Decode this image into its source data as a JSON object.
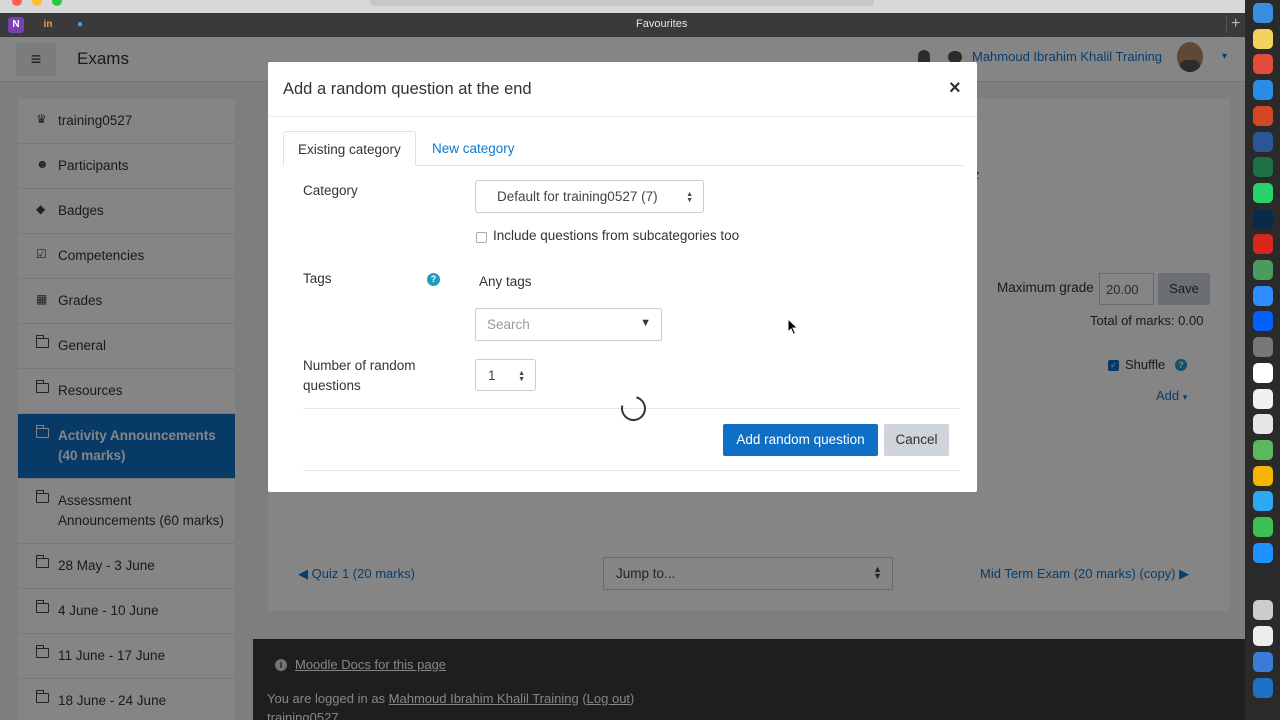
{
  "browser": {
    "favourites_title": "Favourites",
    "fav_icons": [
      {
        "name": "onenote-icon",
        "glyph": "N",
        "color": "#7b3fb4"
      },
      {
        "name": "in-icon",
        "glyph": "in",
        "color": "#c96b12"
      },
      {
        "name": "site-icon",
        "glyph": "•",
        "color": "#1e7fd6"
      }
    ]
  },
  "dock_icons": [
    {
      "name": "finder-icon",
      "color": "#3a8de0"
    },
    {
      "name": "notes-icon",
      "color": "#f3d35d"
    },
    {
      "name": "chrome-icon",
      "color": "#e14d3a"
    },
    {
      "name": "safari-icon",
      "color": "#2a8ce6"
    },
    {
      "name": "powerpoint-icon",
      "color": "#d24726"
    },
    {
      "name": "word-icon",
      "color": "#2b5797"
    },
    {
      "name": "excel-icon",
      "color": "#1e7145"
    },
    {
      "name": "whatsapp-icon",
      "color": "#25d366"
    },
    {
      "name": "photoshop-icon",
      "color": "#0b2a4a"
    },
    {
      "name": "acrobat-icon",
      "color": "#d9261c"
    },
    {
      "name": "drive-icon",
      "color": "#4a9c5e"
    },
    {
      "name": "zoom-icon",
      "color": "#2d8cff"
    },
    {
      "name": "dropbox-icon",
      "color": "#0061fe"
    },
    {
      "name": "launchpad-icon",
      "color": "#777777"
    },
    {
      "name": "calendar-icon",
      "color": "#ffffff"
    },
    {
      "name": "textedit-icon",
      "color": "#f0f0f0"
    },
    {
      "name": "preview-icon",
      "color": "#e6e6e6"
    },
    {
      "name": "maps-icon",
      "color": "#5cb85c"
    },
    {
      "name": "photos-icon",
      "color": "#f4b400"
    },
    {
      "name": "messages-icon",
      "color": "#2fa8f3"
    },
    {
      "name": "facetime-icon",
      "color": "#3cc150"
    },
    {
      "name": "appstore-icon",
      "color": "#1e90ff"
    },
    {
      "name": "trash-icon",
      "color": "#cccccc"
    },
    {
      "name": "file-icon",
      "color": "#eeeeee"
    },
    {
      "name": "browser-icon",
      "color": "#3a7bd5"
    },
    {
      "name": "language-icon",
      "color": "#1f6fc2"
    }
  ],
  "navbar": {
    "menu_glyph": "≡",
    "site_name": "Exams",
    "user_name": "Mahmoud Ibrahim Khalil Training",
    "caret": "▾"
  },
  "sidebar": {
    "items": [
      {
        "label": "training0527",
        "icon": "graduation-cap-icon",
        "glyph": "♛",
        "active": false
      },
      {
        "label": "Participants",
        "icon": "users-icon",
        "glyph": "☻",
        "active": false
      },
      {
        "label": "Badges",
        "icon": "shield-icon",
        "glyph": "◆",
        "active": false
      },
      {
        "label": "Competencies",
        "icon": "checkbox-icon",
        "glyph": "☑",
        "active": false
      },
      {
        "label": "Grades",
        "icon": "table-icon",
        "glyph": "▦",
        "active": false
      },
      {
        "label": "General",
        "icon": "folder-icon",
        "active": false
      },
      {
        "label": "Resources",
        "icon": "folder-icon",
        "active": false
      },
      {
        "label": "Activity Announcements (40 marks)",
        "icon": "folder-icon",
        "active": true
      },
      {
        "label": "Assessment Announcements (60 marks)",
        "icon": "folder-icon",
        "active": false
      },
      {
        "label": "28 May - 3 June",
        "icon": "folder-icon",
        "active": false
      },
      {
        "label": "4 June - 10 June",
        "icon": "folder-icon",
        "active": false
      },
      {
        "label": "11 June - 17 June",
        "icon": "folder-icon",
        "active": false
      },
      {
        "label": "18 June - 24 June",
        "icon": "folder-icon",
        "active": false
      }
    ]
  },
  "main": {
    "partial_z": "z",
    "max_grade_label": "Maximum grade",
    "max_grade_value": "20.00",
    "save_label": "Save",
    "total_marks": "Total of marks: 0.00",
    "shuffle_label": "Shuffle",
    "add_label": "Add",
    "prev_link": "◀ Quiz 1 (20 marks)",
    "jump_placeholder": "Jump to...",
    "next_link": "Mid Term Exam (20 marks) (copy) ▶"
  },
  "footer": {
    "docs_link": "Moodle Docs for this page",
    "logged_prefix": "You are logged in as ",
    "logged_user": "Mahmoud Ibrahim Khalil Training",
    "logout_prefix": " (",
    "logout_label": "Log out",
    "logout_suffix": ")",
    "course": "training0527"
  },
  "modal": {
    "title": "Add a random question at the end",
    "close_glyph": "×",
    "tabs": [
      "Existing category",
      "New category"
    ],
    "category_label": "Category",
    "category_value": "Default for training0527 (7)",
    "include_sub_label": "Include questions from subcategories too",
    "include_sub_checked": false,
    "tags_label": "Tags",
    "any_tags": "Any tags",
    "search_placeholder": "Search",
    "num_label": "Number of random questions",
    "num_value": "1",
    "add_button": "Add random question",
    "cancel_button": "Cancel"
  }
}
